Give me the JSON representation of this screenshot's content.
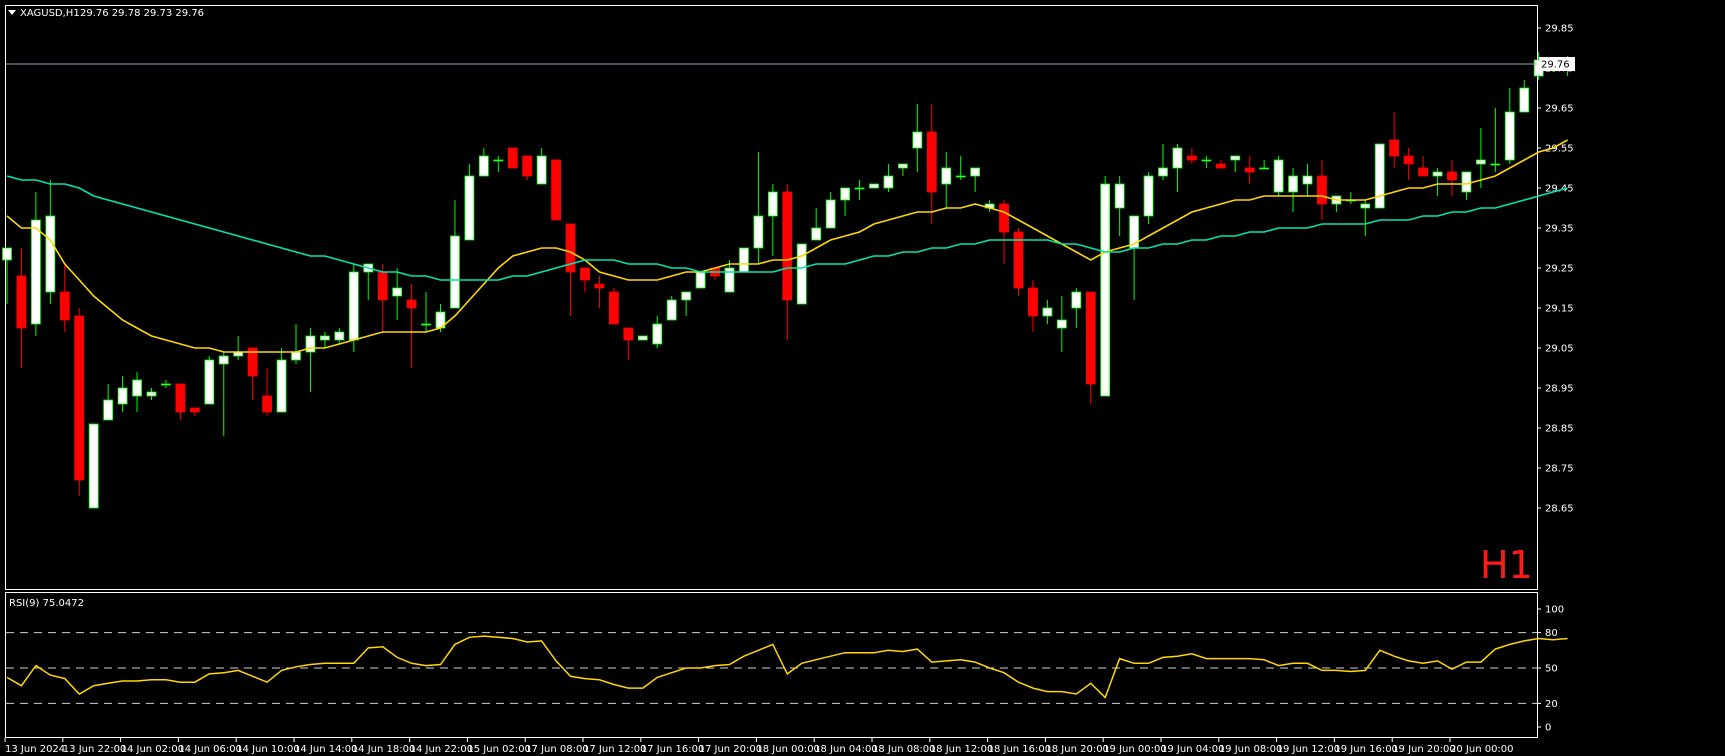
{
  "header": {
    "symbol": "XAGUSD,H1",
    "ohlc": "29.76 29.78 29.73 29.76"
  },
  "timeframe_label": "H1",
  "price_tag": "29.76",
  "rsi_header": "RSI(9) 75.0472",
  "colors": {
    "bull_fill": "#ffffff",
    "bear_fill": "#ff0000",
    "bull_wick": "#00ff00",
    "bear_wick": "#ff0000",
    "ma_fast": "#ffd700",
    "ma_slow": "#00e5b0",
    "rsi_line": "#ffd700",
    "timeframe_label": "#ff1a1a"
  },
  "chart_data": [
    {
      "type": "candlestick",
      "title": "XAGUSD,H1",
      "ylim": [
        28.6,
        29.9
      ],
      "y_ticks": [
        "29.85",
        "29.75",
        "29.65",
        "29.55",
        "29.45",
        "29.35",
        "29.25",
        "29.15",
        "29.05",
        "28.95",
        "28.85",
        "28.75",
        "28.65"
      ],
      "x_ticks": [
        "13 Jun 2024",
        "13 Jun 22:00",
        "14 Jun 02:00",
        "14 Jun 06:00",
        "14 Jun 10:00",
        "14 Jun 14:00",
        "14 Jun 18:00",
        "14 Jun 22:00",
        "15 Jun 02:00",
        "17 Jun 08:00",
        "17 Jun 12:00",
        "17 Jun 16:00",
        "17 Jun 20:00",
        "18 Jun 00:00",
        "18 Jun 04:00",
        "18 Jun 08:00",
        "18 Jun 12:00",
        "18 Jun 16:00",
        "18 Jun 20:00",
        "19 Jun 00:00",
        "19 Jun 04:00",
        "19 Jun 08:00",
        "19 Jun 12:00",
        "19 Jun 16:00",
        "19 Jun 20:00",
        "20 Jun 00:00"
      ],
      "current_price": 29.76,
      "candles": [
        [
          29.27,
          29.3,
          29.16,
          29.3
        ],
        [
          29.23,
          29.3,
          29.0,
          29.1
        ],
        [
          29.11,
          29.44,
          29.08,
          29.37
        ],
        [
          29.19,
          29.47,
          29.16,
          29.38
        ],
        [
          29.19,
          29.26,
          29.09,
          29.12
        ],
        [
          29.13,
          29.15,
          28.68,
          28.72
        ],
        [
          28.65,
          28.86,
          28.65,
          28.86
        ],
        [
          28.87,
          28.96,
          28.87,
          28.92
        ],
        [
          28.91,
          28.98,
          28.89,
          28.95
        ],
        [
          28.93,
          28.99,
          28.89,
          28.97
        ],
        [
          28.93,
          28.95,
          28.92,
          28.94
        ],
        [
          28.96,
          28.97,
          28.95,
          28.96
        ],
        [
          28.96,
          28.96,
          28.87,
          28.89
        ],
        [
          28.9,
          28.9,
          28.88,
          28.89
        ],
        [
          28.91,
          29.03,
          28.91,
          29.02
        ],
        [
          29.01,
          29.04,
          28.83,
          29.03
        ],
        [
          29.03,
          29.08,
          29.02,
          29.04
        ],
        [
          29.05,
          29.05,
          28.92,
          28.98
        ],
        [
          28.93,
          29.0,
          28.88,
          28.89
        ],
        [
          28.89,
          29.05,
          28.89,
          29.02
        ],
        [
          29.02,
          29.11,
          29.01,
          29.04
        ],
        [
          29.04,
          29.1,
          28.94,
          29.08
        ],
        [
          29.07,
          29.09,
          29.05,
          29.08
        ],
        [
          29.07,
          29.1,
          29.06,
          29.09
        ],
        [
          29.07,
          29.26,
          29.04,
          29.24
        ],
        [
          29.24,
          29.26,
          29.17,
          29.26
        ],
        [
          29.24,
          29.26,
          29.09,
          29.17
        ],
        [
          29.18,
          29.25,
          29.12,
          29.2
        ],
        [
          29.17,
          29.21,
          29.0,
          29.15
        ],
        [
          29.11,
          29.19,
          29.09,
          29.11
        ],
        [
          29.1,
          29.16,
          29.09,
          29.14
        ],
        [
          29.15,
          29.42,
          29.15,
          29.33
        ],
        [
          29.32,
          29.51,
          29.32,
          29.48
        ],
        [
          29.48,
          29.55,
          29.48,
          29.53
        ],
        [
          29.52,
          29.53,
          29.49,
          29.52
        ],
        [
          29.55,
          29.55,
          29.5,
          29.5
        ],
        [
          29.53,
          29.53,
          29.47,
          29.48
        ],
        [
          29.46,
          29.55,
          29.48,
          29.53
        ],
        [
          29.52,
          29.52,
          29.37,
          29.37
        ],
        [
          29.36,
          29.35,
          29.13,
          29.24
        ],
        [
          29.25,
          29.25,
          29.19,
          29.22
        ],
        [
          29.21,
          29.23,
          29.15,
          29.2
        ],
        [
          29.19,
          29.2,
          29.11,
          29.11
        ],
        [
          29.1,
          29.1,
          29.02,
          29.07
        ],
        [
          29.07,
          29.08,
          29.07,
          29.08
        ],
        [
          29.06,
          29.13,
          29.05,
          29.11
        ],
        [
          29.12,
          29.18,
          29.12,
          29.17
        ],
        [
          29.17,
          29.18,
          29.13,
          29.19
        ],
        [
          29.2,
          29.24,
          29.21,
          29.24
        ],
        [
          29.25,
          29.24,
          29.22,
          29.23
        ],
        [
          29.19,
          29.27,
          29.19,
          29.25
        ],
        [
          29.24,
          29.27,
          29.29,
          29.3
        ],
        [
          29.3,
          29.54,
          29.26,
          29.38
        ],
        [
          29.38,
          29.46,
          29.28,
          29.44
        ],
        [
          29.44,
          29.46,
          29.07,
          29.17
        ],
        [
          29.16,
          29.31,
          29.16,
          29.31
        ],
        [
          29.32,
          29.4,
          29.32,
          29.35
        ],
        [
          29.35,
          29.44,
          29.35,
          29.42
        ],
        [
          29.42,
          29.45,
          29.38,
          29.45
        ],
        [
          29.45,
          29.47,
          29.42,
          29.45
        ],
        [
          29.45,
          29.46,
          29.45,
          29.46
        ],
        [
          29.45,
          29.51,
          29.44,
          29.48
        ],
        [
          29.5,
          29.51,
          29.48,
          29.51
        ],
        [
          29.55,
          29.66,
          29.49,
          29.59
        ],
        [
          29.59,
          29.66,
          29.36,
          29.44
        ],
        [
          29.46,
          29.54,
          29.4,
          29.5
        ],
        [
          29.48,
          29.53,
          29.47,
          29.48
        ],
        [
          29.48,
          29.5,
          29.44,
          29.5
        ],
        [
          29.4,
          29.42,
          29.39,
          29.41
        ],
        [
          29.41,
          29.42,
          29.26,
          29.34
        ],
        [
          29.34,
          29.35,
          29.18,
          29.2
        ],
        [
          29.2,
          29.22,
          29.09,
          29.13
        ],
        [
          29.13,
          29.17,
          29.11,
          29.15
        ],
        [
          29.1,
          29.18,
          29.04,
          29.12
        ],
        [
          29.15,
          29.2,
          29.1,
          29.19
        ],
        [
          29.19,
          29.19,
          28.91,
          28.96
        ],
        [
          28.93,
          29.48,
          28.93,
          29.46
        ],
        [
          29.4,
          29.48,
          29.33,
          29.46
        ],
        [
          29.3,
          29.38,
          29.17,
          29.38
        ],
        [
          29.38,
          29.49,
          29.36,
          29.48
        ],
        [
          29.48,
          29.56,
          29.47,
          29.5
        ],
        [
          29.5,
          29.56,
          29.44,
          29.55
        ],
        [
          29.53,
          29.55,
          29.51,
          29.52
        ],
        [
          29.52,
          29.53,
          29.5,
          29.52
        ],
        [
          29.51,
          29.52,
          29.5,
          29.5
        ],
        [
          29.52,
          29.53,
          29.49,
          29.53
        ],
        [
          29.5,
          29.53,
          29.46,
          29.49
        ],
        [
          29.5,
          29.52,
          29.5,
          29.5
        ],
        [
          29.44,
          29.53,
          29.43,
          29.52
        ],
        [
          29.44,
          29.5,
          29.39,
          29.48
        ],
        [
          29.46,
          29.51,
          29.43,
          29.48
        ],
        [
          29.48,
          29.52,
          29.37,
          29.41
        ],
        [
          29.41,
          29.43,
          29.39,
          29.43
        ],
        [
          29.42,
          29.44,
          29.41,
          29.42
        ],
        [
          29.4,
          29.42,
          29.33,
          29.41
        ],
        [
          29.4,
          29.55,
          29.4,
          29.56
        ],
        [
          29.57,
          29.64,
          29.5,
          29.53
        ],
        [
          29.53,
          29.55,
          29.47,
          29.51
        ],
        [
          29.5,
          29.53,
          29.48,
          29.48
        ],
        [
          29.48,
          29.5,
          29.43,
          29.49
        ],
        [
          29.49,
          29.52,
          29.43,
          29.47
        ],
        [
          29.44,
          29.49,
          29.42,
          29.49
        ],
        [
          29.51,
          29.6,
          29.45,
          29.52
        ],
        [
          29.51,
          29.65,
          29.49,
          29.51
        ],
        [
          29.52,
          29.7,
          29.51,
          29.64
        ],
        [
          29.64,
          29.72,
          29.64,
          29.7
        ],
        [
          29.73,
          29.79,
          29.72,
          29.77
        ],
        [
          29.76,
          29.77,
          29.74,
          29.76
        ],
        [
          29.76,
          29.78,
          29.73,
          29.76
        ]
      ],
      "series": [
        {
          "name": "",
          "values": [
            29.38,
            29.35,
            29.35,
            29.32,
            29.26,
            29.22,
            29.18,
            29.15,
            29.12,
            29.1,
            29.08,
            29.07,
            29.06,
            29.05,
            29.05,
            29.04,
            29.04,
            29.04,
            29.04,
            29.04,
            29.04,
            29.05,
            29.05,
            29.06,
            29.07,
            29.08,
            29.09,
            29.09,
            29.09,
            29.09,
            29.1,
            29.13,
            29.17,
            29.21,
            29.25,
            29.28,
            29.29,
            29.3,
            29.3,
            29.29,
            29.27,
            29.24,
            29.23,
            29.22,
            29.22,
            29.22,
            29.23,
            29.24,
            29.24,
            29.25,
            29.26,
            29.26,
            29.26,
            29.27,
            29.27,
            29.28,
            29.3,
            29.32,
            29.33,
            29.34,
            29.36,
            29.37,
            29.38,
            29.39,
            29.39,
            29.4,
            29.4,
            29.41,
            29.4,
            29.39,
            29.37,
            29.35,
            29.33,
            29.31,
            29.29,
            29.27,
            29.29,
            29.3,
            29.31,
            29.33,
            29.35,
            29.37,
            29.39,
            29.4,
            29.41,
            29.42,
            29.42,
            29.43,
            29.43,
            29.43,
            29.43,
            29.43,
            29.42,
            29.42,
            29.42,
            29.43,
            29.44,
            29.45,
            29.45,
            29.46,
            29.46,
            29.46,
            29.47,
            29.48,
            29.5,
            29.52,
            29.54,
            29.55,
            29.57
          ]
        },
        {
          "name": "",
          "values": [
            29.48,
            29.47,
            29.47,
            29.46,
            29.46,
            29.45,
            29.43,
            29.42,
            29.41,
            29.4,
            29.39,
            29.38,
            29.37,
            29.36,
            29.35,
            29.34,
            29.33,
            29.32,
            29.31,
            29.3,
            29.29,
            29.28,
            29.28,
            29.27,
            29.26,
            29.25,
            29.24,
            29.24,
            29.23,
            29.23,
            29.22,
            29.22,
            29.22,
            29.22,
            29.22,
            29.23,
            29.23,
            29.24,
            29.25,
            29.26,
            29.27,
            29.27,
            29.27,
            29.26,
            29.26,
            29.26,
            29.25,
            29.25,
            29.24,
            29.24,
            29.24,
            29.24,
            29.24,
            29.24,
            29.25,
            29.25,
            29.26,
            29.26,
            29.26,
            29.27,
            29.28,
            29.28,
            29.29,
            29.29,
            29.3,
            29.3,
            29.31,
            29.31,
            29.32,
            29.32,
            29.32,
            29.32,
            29.32,
            29.31,
            29.31,
            29.3,
            29.29,
            29.29,
            29.3,
            29.3,
            29.31,
            29.31,
            29.32,
            29.32,
            29.33,
            29.33,
            29.34,
            29.34,
            29.35,
            29.35,
            29.35,
            29.36,
            29.36,
            29.36,
            29.36,
            29.37,
            29.37,
            29.37,
            29.38,
            29.38,
            29.39,
            29.39,
            29.4,
            29.4,
            29.41,
            29.42,
            29.43,
            29.44,
            29.45
          ]
        }
      ]
    },
    {
      "type": "line",
      "title": "RSI(9) 75.0472",
      "ylim": [
        0,
        100
      ],
      "y_ticks": [
        "100",
        "80",
        "50",
        "20",
        "0"
      ],
      "levels": [
        80,
        50,
        20
      ],
      "series": [
        {
          "name": "",
          "values": [
            42,
            35,
            52,
            44,
            41,
            28,
            35,
            37,
            39,
            39,
            40,
            40,
            38,
            38,
            45,
            46,
            48,
            43,
            38,
            48,
            51,
            53,
            54,
            54,
            54,
            67,
            68,
            59,
            54,
            52,
            53,
            70,
            76,
            77,
            76,
            75,
            72,
            73,
            56,
            43,
            41,
            40,
            36,
            33,
            33,
            42,
            46,
            50,
            50,
            52,
            53,
            60,
            65,
            70,
            45,
            54,
            57,
            60,
            63,
            63,
            63,
            65,
            64,
            66,
            55,
            56,
            57,
            55,
            50,
            46,
            38,
            33,
            30,
            30,
            28,
            37,
            25,
            58,
            54,
            54,
            59,
            60,
            62,
            58,
            58,
            58,
            58,
            57,
            52,
            54,
            54,
            48,
            48,
            47,
            48,
            65,
            60,
            56,
            54,
            56,
            49,
            55,
            55,
            66,
            70,
            73,
            75,
            74,
            75
          ]
        }
      ]
    }
  ]
}
